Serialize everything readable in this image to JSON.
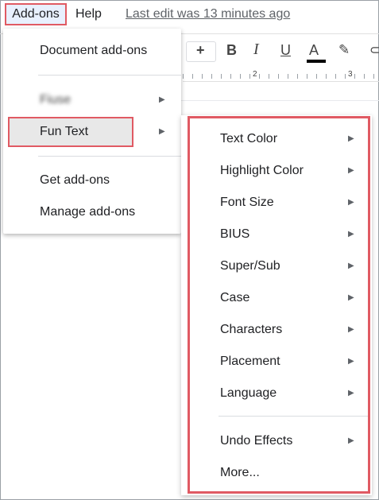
{
  "menubar": {
    "addons_label": "Add-ons",
    "help_label": "Help",
    "last_edit": "Last edit was 13 minutes ago"
  },
  "toolbar": {
    "plus": "+",
    "bold": "B",
    "italic": "I",
    "underline": "U",
    "text_color": "A",
    "marker_icon": "✎",
    "more_icon": "⊂",
    "icons": [
      "plus-icon",
      "bold-icon",
      "italic-icon",
      "underline-icon",
      "text-color-icon",
      "highlighter-icon",
      "link-icon"
    ]
  },
  "ruler": {
    "marks": [
      "2",
      "3"
    ]
  },
  "dropdown": {
    "items": [
      {
        "label": "Document add-ons"
      },
      {
        "label": "Fiuse",
        "blurred": true,
        "arrow": "▶"
      },
      {
        "label": "Fun Text",
        "arrow": "▶",
        "highlighted": true
      },
      {
        "label": "Get add-ons"
      },
      {
        "label": "Manage add-ons"
      }
    ]
  },
  "submenu": {
    "items": [
      {
        "label": "Text Color",
        "arrow": "▶"
      },
      {
        "label": "Highlight Color",
        "arrow": "▶"
      },
      {
        "label": "Font Size",
        "arrow": "▶"
      },
      {
        "label": "BIUS",
        "arrow": "▶"
      },
      {
        "label": "Super/Sub",
        "arrow": "▶"
      },
      {
        "label": "Case",
        "arrow": "▶"
      },
      {
        "label": "Characters",
        "arrow": "▶"
      },
      {
        "label": "Placement",
        "arrow": "▶"
      },
      {
        "label": "Language",
        "arrow": "▶"
      },
      {
        "label": "Undo Effects",
        "arrow": "▶"
      },
      {
        "label": "More..."
      }
    ]
  },
  "colors": {
    "highlight_border": "#e05a63",
    "menu_active_bg": "#e8f0fe",
    "hover_bg": "#e8e8e8"
  }
}
